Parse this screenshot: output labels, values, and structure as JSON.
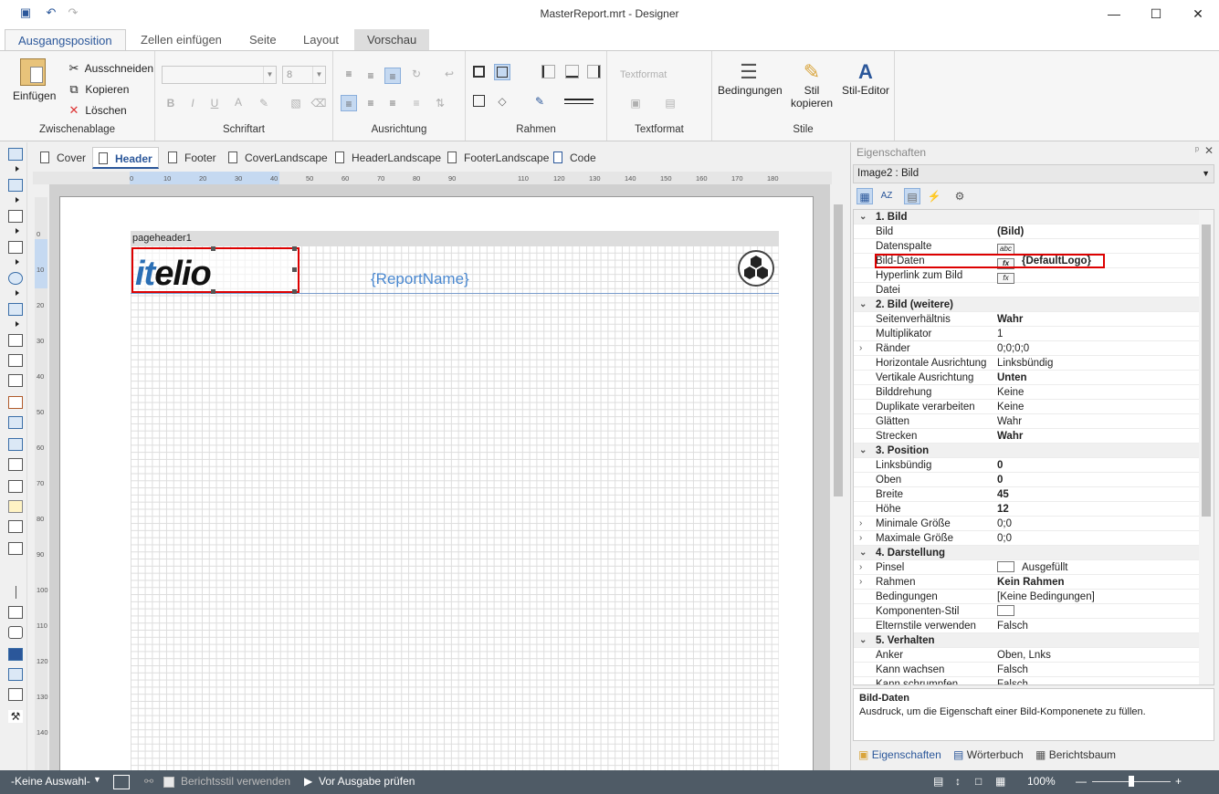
{
  "window": {
    "title": "MasterReport.mrt - Designer",
    "min": "—",
    "max": "☐",
    "close": "✕"
  },
  "ribbon_tabs": [
    "Ausgangsposition",
    "Zellen einfügen",
    "Seite",
    "Layout",
    "Vorschau"
  ],
  "clipboard": {
    "paste": "Einfügen",
    "cut": "Ausschneiden",
    "copy": "Kopieren",
    "delete": "Löschen",
    "group": "Zwischenablage"
  },
  "font": {
    "size": "8",
    "bold": "B",
    "italic": "I",
    "underline": "U",
    "color": "A",
    "group": "Schriftart"
  },
  "alignment": {
    "group": "Ausrichtung"
  },
  "borders": {
    "group": "Rahmen"
  },
  "textformat": {
    "label": "Textformat",
    "group": "Textformat"
  },
  "styles": {
    "conditions": "Bedingungen",
    "copy_style": "Stil kopieren",
    "style_editor": "Stil-Editor",
    "group": "Stile"
  },
  "doc_tabs": [
    "Cover",
    "Header",
    "Footer",
    "CoverLandscape",
    "HeaderLandscape",
    "FooterLandscape",
    "Code"
  ],
  "hruler": [
    "0",
    "10",
    "20",
    "30",
    "40",
    "50",
    "60",
    "70",
    "80",
    "90",
    "110",
    "120",
    "130",
    "140",
    "150",
    "160",
    "170",
    "180"
  ],
  "vruler": [
    "0",
    "10",
    "20",
    "30",
    "40",
    "50",
    "60",
    "70",
    "80",
    "90",
    "100",
    "110",
    "120",
    "130",
    "140"
  ],
  "designer": {
    "band_name": "pageheader1",
    "logo_text_blue": "it",
    "logo_text_black": "elio",
    "report_name": "{ReportName}"
  },
  "properties": {
    "title": "Eigenschaften",
    "pin": "ᵖ",
    "object": "Image2 : Bild",
    "rows": [
      {
        "type": "cat",
        "name": "1. Bild"
      },
      {
        "name": "Bild",
        "value": "(Bild)",
        "bold": true
      },
      {
        "name": "Datenspalte",
        "value": "",
        "icon": "abc"
      },
      {
        "name": "Bild-Daten",
        "value": "{DefaultLogo}",
        "bold": true,
        "icon": "fx"
      },
      {
        "name": "Hyperlink zum Bild",
        "value": "",
        "icon": "fx"
      },
      {
        "name": "Datei",
        "value": ""
      },
      {
        "type": "cat",
        "name": "2. Bild (weitere)"
      },
      {
        "name": "Seitenverhältnis",
        "value": "Wahr",
        "bold": true
      },
      {
        "name": "Multiplikator",
        "value": "1"
      },
      {
        "name": "Ränder",
        "value": "0;0;0;0",
        "expand": true
      },
      {
        "name": "Horizontale Ausrichtung",
        "value": "Linksbündig"
      },
      {
        "name": "Vertikale Ausrichtung",
        "value": "Unten",
        "bold": true
      },
      {
        "name": "Bilddrehung",
        "value": "Keine"
      },
      {
        "name": "Duplikate verarbeiten",
        "value": "Keine"
      },
      {
        "name": "Glätten",
        "value": "Wahr"
      },
      {
        "name": "Strecken",
        "value": "Wahr",
        "bold": true
      },
      {
        "type": "cat",
        "name": "3. Position"
      },
      {
        "name": "Linksbündig",
        "value": "0",
        "bold": true
      },
      {
        "name": "Oben",
        "value": "0",
        "bold": true
      },
      {
        "name": "Breite",
        "value": "45",
        "bold": true
      },
      {
        "name": "Höhe",
        "value": "12",
        "bold": true
      },
      {
        "name": "Minimale Größe",
        "value": "0;0",
        "expand": true
      },
      {
        "name": "Maximale Größe",
        "value": "0;0",
        "expand": true
      },
      {
        "type": "cat",
        "name": "4. Darstellung"
      },
      {
        "name": "Pinsel",
        "value": "Ausgefüllt",
        "expand": true,
        "icon": "swatch"
      },
      {
        "name": "Rahmen",
        "value": "Kein Rahmen",
        "bold": true,
        "expand": true
      },
      {
        "name": "Bedingungen",
        "value": "[Keine Bedingungen]"
      },
      {
        "name": "Komponenten-Stil",
        "value": "",
        "icon": "swatch"
      },
      {
        "name": "Elternstile verwenden",
        "value": "Falsch"
      },
      {
        "type": "cat",
        "name": "5. Verhalten"
      },
      {
        "name": "Anker",
        "value": "Oben, Lnks"
      },
      {
        "name": "Kann wachsen",
        "value": "Falsch"
      },
      {
        "name": "Kann schrumpfen",
        "value": "Falsch"
      }
    ],
    "desc_title": "Bild-Daten",
    "desc_text": "Ausdruck, um die Eigenschaft einer Bild-Komponenete zu füllen.",
    "tabs": [
      "Eigenschaften",
      "Wörterbuch",
      "Berichtsbaum"
    ]
  },
  "status": {
    "selection": "-Keine Auswahl-",
    "style_check": "Berichtsstil verwenden",
    "check": "Vor Ausgabe prüfen",
    "zoom": "100%",
    "zoom_level": 100
  },
  "colors": {
    "accent": "#2b579a",
    "status_bg": "#4f5b66",
    "highlight": "#dd0000"
  }
}
